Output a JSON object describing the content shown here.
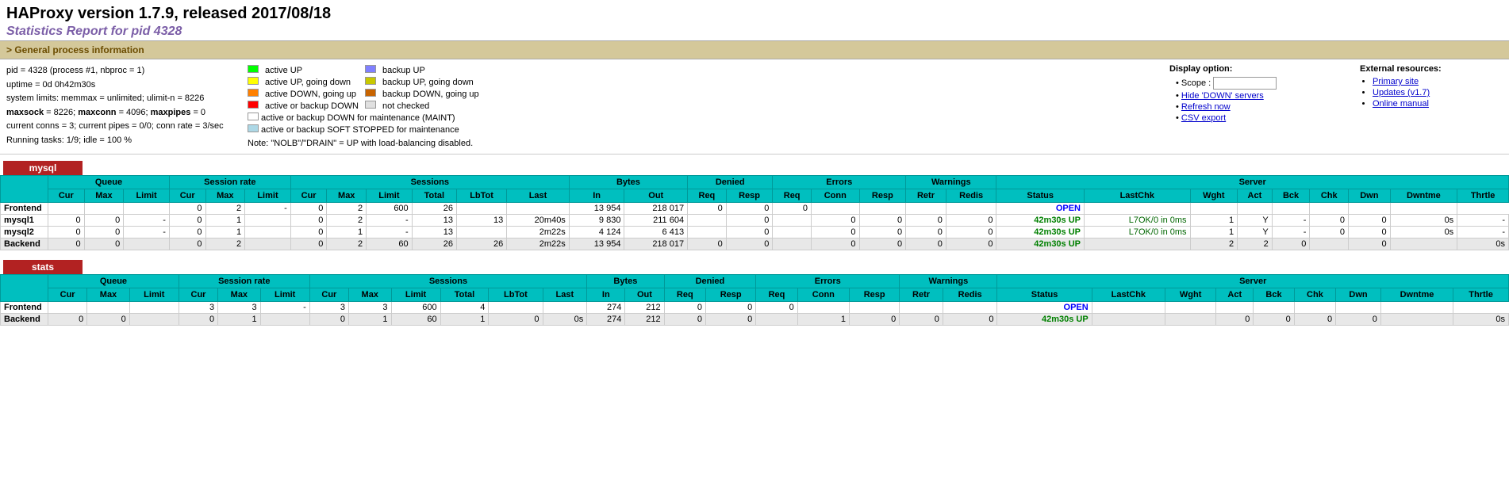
{
  "header": {
    "title": "HAProxy version 1.7.9, released 2017/08/18",
    "subtitle": "Statistics Report for pid 4328"
  },
  "general_section": {
    "label": "General process information",
    "pid_info": "pid = 4328 (process #1, nbproc = 1)",
    "uptime": "uptime = 0d 0h42m30s",
    "system_limits": "system limits: memmax = unlimited; ulimit-n = 8226",
    "maxsock": "maxsock = 8226; maxconn = 4096; maxpipes = 0",
    "current_conns": "current conns = 3; current pipes = 0/0; conn rate = 3/sec",
    "running_tasks": "Running tasks: 1/9; idle = 100 %"
  },
  "legend": {
    "items": [
      {
        "color": "lc-green",
        "label": "active UP"
      },
      {
        "color": "lc-yellow",
        "label": "active UP, going down"
      },
      {
        "color": "lc-orange",
        "label": "active DOWN, going up"
      },
      {
        "color": "lc-red",
        "label": "active or backup DOWN"
      },
      {
        "color": "lc-white",
        "label": "active or backup DOWN for maintenance (MAINT)"
      },
      {
        "color": "lc-lightblue",
        "label": "active or backup SOFT STOPPED for maintenance"
      },
      {
        "color": "lc-blue-backup",
        "label": "backup UP"
      },
      {
        "color": "lc-yellow-backup",
        "label": "backup UP, going down"
      },
      {
        "color": "lc-orange-backup",
        "label": "backup DOWN, going up"
      },
      {
        "color": "lc-notchecked",
        "label": "not checked"
      }
    ],
    "note": "Note: \"NOLB\"/\"DRAIN\" = UP with load-balancing disabled."
  },
  "display_options": {
    "title": "Display option:",
    "scope_label": "Scope :",
    "links": [
      {
        "label": "Hide 'DOWN' servers",
        "href": "#"
      },
      {
        "label": "Refresh now",
        "href": "#"
      },
      {
        "label": "CSV export",
        "href": "#"
      }
    ]
  },
  "external_resources": {
    "title": "External resources:",
    "links": [
      {
        "label": "Primary site",
        "href": "#"
      },
      {
        "label": "Updates (v1.7)",
        "href": "#"
      },
      {
        "label": "Online manual",
        "href": "#"
      }
    ]
  },
  "proxies": [
    {
      "name": "mysql",
      "rows": [
        {
          "type": "Frontend",
          "queue_cur": "",
          "queue_max": "",
          "queue_limit": "",
          "sess_cur": "0",
          "sess_max": "2",
          "sess_limit": "-",
          "sessions_cur": "0",
          "sessions_max": "2",
          "sessions_limit": "600",
          "sessions_total": "26",
          "sessions_lbtot": "",
          "sessions_last": "",
          "bytes_in": "13 954",
          "bytes_out": "218 017",
          "denied_req": "0",
          "denied_resp": "0",
          "errors_req": "0",
          "errors_conn": "",
          "errors_resp": "",
          "warn_retr": "",
          "warn_redis": "",
          "status": "OPEN",
          "lastchk": "",
          "wght": "",
          "act": "",
          "bck": "",
          "chk": "",
          "dwn": "",
          "dwntme": "",
          "thrtle": ""
        },
        {
          "type": "mysql1",
          "queue_cur": "0",
          "queue_max": "0",
          "queue_limit": "-",
          "sess_cur": "0",
          "sess_max": "1",
          "sess_limit": "",
          "sessions_cur": "0",
          "sessions_max": "2",
          "sessions_limit": "-",
          "sessions_total": "13",
          "sessions_lbtot": "13",
          "sessions_last": "20m40s",
          "bytes_in": "9 830",
          "bytes_out": "211 604",
          "denied_req": "",
          "denied_resp": "0",
          "errors_req": "",
          "errors_conn": "0",
          "errors_resp": "0",
          "warn_retr": "0",
          "warn_redis": "0",
          "status": "42m30s UP",
          "lastchk": "L7OK/0 in 0ms",
          "wght": "1",
          "act": "Y",
          "bck": "-",
          "chk": "0",
          "dwn": "0",
          "dwntme": "0s",
          "thrtle": "-"
        },
        {
          "type": "mysql2",
          "queue_cur": "0",
          "queue_max": "0",
          "queue_limit": "-",
          "sess_cur": "0",
          "sess_max": "1",
          "sess_limit": "",
          "sessions_cur": "0",
          "sessions_max": "1",
          "sessions_limit": "-",
          "sessions_total": "13",
          "sessions_lbtot": "",
          "sessions_last": "2m22s",
          "bytes_in": "4 124",
          "bytes_out": "6 413",
          "denied_req": "",
          "denied_resp": "0",
          "errors_req": "",
          "errors_conn": "0",
          "errors_resp": "0",
          "warn_retr": "0",
          "warn_redis": "0",
          "status": "42m30s UP",
          "lastchk": "L7OK/0 in 0ms",
          "wght": "1",
          "act": "Y",
          "bck": "-",
          "chk": "0",
          "dwn": "0",
          "dwntme": "0s",
          "thrtle": "-"
        },
        {
          "type": "Backend",
          "queue_cur": "0",
          "queue_max": "0",
          "queue_limit": "",
          "sess_cur": "0",
          "sess_max": "2",
          "sess_limit": "",
          "sessions_cur": "0",
          "sessions_max": "2",
          "sessions_limit": "60",
          "sessions_total": "26",
          "sessions_lbtot": "26",
          "sessions_last": "2m22s",
          "bytes_in": "13 954",
          "bytes_out": "218 017",
          "denied_req": "0",
          "denied_resp": "0",
          "errors_req": "",
          "errors_conn": "0",
          "errors_resp": "0",
          "warn_retr": "0",
          "warn_redis": "0",
          "status": "42m30s UP",
          "lastchk": "",
          "wght": "2",
          "act": "2",
          "bck": "0",
          "chk": "",
          "dwn": "0",
          "dwntme": "",
          "thrtle": "0s"
        }
      ]
    },
    {
      "name": "stats",
      "rows": [
        {
          "type": "Frontend",
          "queue_cur": "",
          "queue_max": "",
          "queue_limit": "",
          "sess_cur": "3",
          "sess_max": "3",
          "sess_limit": "-",
          "sessions_cur": "3",
          "sessions_max": "3",
          "sessions_limit": "600",
          "sessions_total": "4",
          "sessions_lbtot": "",
          "sessions_last": "",
          "bytes_in": "274",
          "bytes_out": "212",
          "denied_req": "0",
          "denied_resp": "0",
          "errors_req": "0",
          "errors_conn": "",
          "errors_resp": "",
          "warn_retr": "",
          "warn_redis": "",
          "status": "OPEN",
          "lastchk": "",
          "wght": "",
          "act": "",
          "bck": "",
          "chk": "",
          "dwn": "",
          "dwntme": "",
          "thrtle": ""
        },
        {
          "type": "Backend",
          "queue_cur": "0",
          "queue_max": "0",
          "queue_limit": "",
          "sess_cur": "0",
          "sess_max": "1",
          "sess_limit": "",
          "sessions_cur": "0",
          "sessions_max": "1",
          "sessions_limit": "60",
          "sessions_total": "1",
          "sessions_lbtot": "0",
          "sessions_last": "0s",
          "bytes_in": "274",
          "bytes_out": "212",
          "denied_req": "0",
          "denied_resp": "0",
          "errors_req": "",
          "errors_conn": "1",
          "errors_resp": "0",
          "warn_retr": "0",
          "warn_redis": "0",
          "status": "42m30s UP",
          "lastchk": "",
          "wght": "",
          "act": "0",
          "bck": "0",
          "chk": "0",
          "dwn": "0",
          "dwntme": "",
          "thrtle": "0s"
        }
      ]
    }
  ],
  "table_headers": {
    "queue": "Queue",
    "session_rate": "Session rate",
    "sessions": "Sessions",
    "bytes": "Bytes",
    "denied": "Denied",
    "errors": "Errors",
    "warnings": "Warnings",
    "server": "Server",
    "cur": "Cur",
    "max": "Max",
    "limit": "Limit",
    "total": "Total",
    "lbtot": "LbTot",
    "last": "Last",
    "in": "In",
    "out": "Out",
    "req": "Req",
    "resp": "Resp",
    "conn": "Conn",
    "retr": "Retr",
    "redis": "Redis",
    "status": "Status",
    "lastchk": "LastChk",
    "wght": "Wght",
    "act": "Act",
    "bck": "Bck",
    "chk": "Chk",
    "dwn": "Dwn",
    "dwntme": "Dwntme",
    "thrtle": "Thrtle"
  }
}
